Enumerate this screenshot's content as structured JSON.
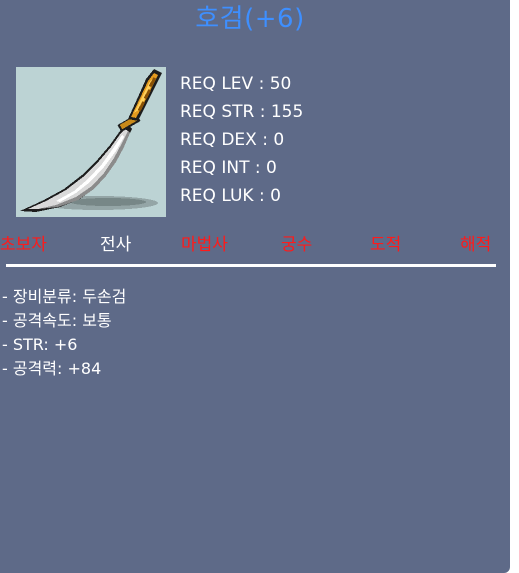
{
  "item": {
    "name": "호검(+6)",
    "name_color": "#3e8fff",
    "icon": "sword-icon"
  },
  "requirements": [
    {
      "label": "REQ LEV : 50"
    },
    {
      "label": "REQ STR : 155"
    },
    {
      "label": "REQ DEX : 0"
    },
    {
      "label": "REQ INT : 0"
    },
    {
      "label": "REQ LUK : 0"
    }
  ],
  "jobs": [
    {
      "label": "초보자",
      "color": "#ff1a1a"
    },
    {
      "label": "전사",
      "color": "#ffffff"
    },
    {
      "label": "마법사",
      "color": "#ff1a1a"
    },
    {
      "label": "궁수",
      "color": "#ff1a1a"
    },
    {
      "label": "도적",
      "color": "#ff1a1a"
    },
    {
      "label": "해적",
      "color": "#ff1a1a"
    }
  ],
  "stats": [
    {
      "label": "- 장비분류: 두손검"
    },
    {
      "label": "- 공격속도: 보통"
    },
    {
      "label": "- STR: +6"
    },
    {
      "label": "- 공격력: +84"
    }
  ],
  "colors": {
    "panel_background": "#5e6a88",
    "image_background": "#bcd3d4",
    "text": "#ffffff",
    "restricted_job": "#ff1a1a"
  }
}
